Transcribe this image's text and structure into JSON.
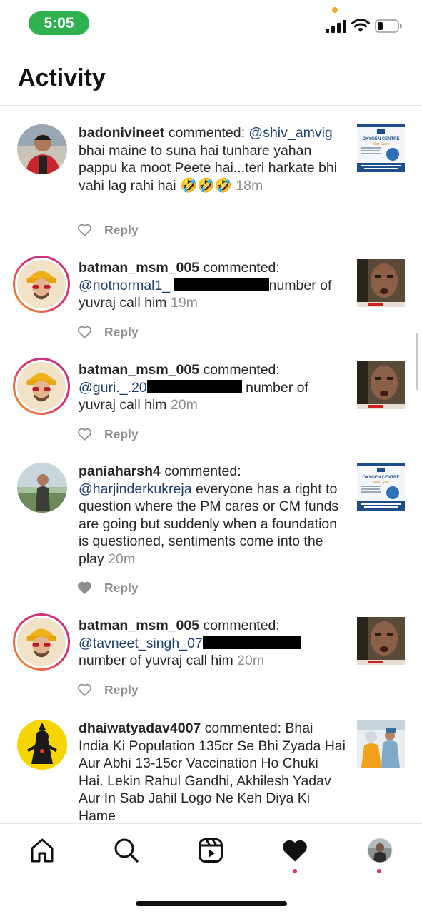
{
  "status_bar": {
    "time": "5:05",
    "icons": [
      "signal-icon",
      "wifi-icon",
      "battery-icon"
    ]
  },
  "header": {
    "title": "Activity"
  },
  "colors": {
    "time_pill": "#2fb14f",
    "story_ring_start": "#f9a21f",
    "story_ring_end": "#c13584",
    "mention": "#1d3f6f",
    "timestamp": "#8e8e8e",
    "notification_dot": "#e1306c"
  },
  "items": [
    {
      "username": "badonivineet",
      "action": " commented: ",
      "mention": "@shiv_amvig",
      "text": " bhai maine to suna hai tunhare yahan pappu ka moot Peete hai...teri harkate bhi vahi lag rahi hai 🤣🤣🤣 ",
      "time": "18m",
      "reply_label": "Reply",
      "thumbnail": "oxygen-centre-poster"
    },
    {
      "username": "batman_msm_005",
      "action": " commented: ",
      "mention": "@notnormal1_",
      "text_after_redaction": "number of yuvraj call him ",
      "time": "19m",
      "reply_label": "Reply",
      "thumbnail": "man-selfie"
    },
    {
      "username": "batman_msm_005",
      "action": " commented: ",
      "mention": "@guri._.20",
      "text_after_redaction": " number of yuvraj call him ",
      "time": "20m",
      "reply_label": "Reply",
      "thumbnail": "man-selfie"
    },
    {
      "username": "paniaharsh4",
      "action": " commented: ",
      "mention": "@harjinderkukreja",
      "text": " everyone has a right to question where the PM cares or CM funds are going but suddenly when a foundation is questioned, sentiments come into the play ",
      "time": "20m",
      "reply_label": "Reply",
      "liked": true,
      "thumbnail": "oxygen-centre-poster"
    },
    {
      "username": "batman_msm_005",
      "action": " commented: ",
      "mention": "@tavneet_singh_07",
      "text_after_redaction": "number of yuvraj call him ",
      "time": "20m",
      "reply_label": "Reply",
      "thumbnail": "man-selfie"
    },
    {
      "username": "dhaiwatyadav4007",
      "action": " commented: ",
      "text": "Bhai India Ki Population 135cr Se Bhi Zyada Hai Aur Abhi 13-15cr Vaccination Ho Chuki Hai. Lekin Rahul Gandhi, Akhilesh Yadav Aur In Sab Jahil Logo Ne Keh Diya Ki Hame",
      "thumbnail": "vaccination-photo"
    }
  ],
  "poster_text": {
    "title": "OXYGEN CENTRE",
    "subtitle": "Now Open"
  },
  "tabbar": [
    "home-icon",
    "search-icon",
    "reels-icon",
    "activity-heart-icon",
    "profile-avatar"
  ]
}
